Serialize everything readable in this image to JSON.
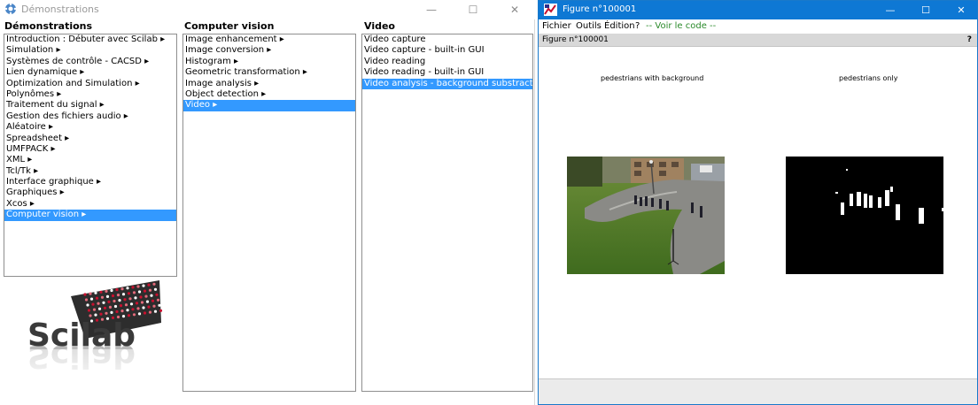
{
  "demo_window": {
    "title": "Démonstrations",
    "minimize_glyph": "—",
    "maximize_glyph": "☐",
    "close_glyph": "✕",
    "columns": [
      {
        "header": "Démonstrations",
        "items": [
          {
            "label": "Introduction : Débuter avec Scilab ▸",
            "selected": false
          },
          {
            "label": "Simulation ▸",
            "selected": false
          },
          {
            "label": "Systèmes de contrôle - CACSD ▸",
            "selected": false
          },
          {
            "label": "Lien dynamique ▸",
            "selected": false
          },
          {
            "label": "Optimization and Simulation ▸",
            "selected": false
          },
          {
            "label": "Polynômes ▸",
            "selected": false
          },
          {
            "label": "Traitement du signal ▸",
            "selected": false
          },
          {
            "label": "Gestion des fichiers audio ▸",
            "selected": false
          },
          {
            "label": "Aléatoire ▸",
            "selected": false
          },
          {
            "label": "Spreadsheet ▸",
            "selected": false
          },
          {
            "label": "UMFPACK ▸",
            "selected": false
          },
          {
            "label": "XML ▸",
            "selected": false
          },
          {
            "label": "Tcl/Tk ▸",
            "selected": false
          },
          {
            "label": "Interface graphique ▸",
            "selected": false
          },
          {
            "label": "Graphiques ▸",
            "selected": false
          },
          {
            "label": "Xcos ▸",
            "selected": false
          },
          {
            "label": "Computer vision ▸",
            "selected": true
          }
        ]
      },
      {
        "header": "Computer vision",
        "items": [
          {
            "label": "Image enhancement ▸",
            "selected": false
          },
          {
            "label": "Image conversion ▸",
            "selected": false
          },
          {
            "label": "Histogram ▸",
            "selected": false
          },
          {
            "label": "Geometric transformation ▸",
            "selected": false
          },
          {
            "label": "Image analysis ▸",
            "selected": false
          },
          {
            "label": "Object detection ▸",
            "selected": false
          },
          {
            "label": "Video ▸",
            "selected": true
          }
        ]
      },
      {
        "header": "Video",
        "items": [
          {
            "label": "Video capture",
            "selected": false
          },
          {
            "label": "Video capture - built-in GUI",
            "selected": false
          },
          {
            "label": "Video reading",
            "selected": false
          },
          {
            "label": "Video reading - built-in GUI",
            "selected": false
          },
          {
            "label": "Video analysis - background substraction",
            "selected": true
          }
        ]
      }
    ],
    "logo": {
      "text": "Scilab"
    }
  },
  "figure_window": {
    "title": "Figure n°100001",
    "minimize_glyph": "—",
    "maximize_glyph": "☐",
    "close_glyph": "✕",
    "menu": {
      "fichier": "Fichier",
      "outils": "Outils",
      "edition": "Édition",
      "help": "?",
      "voir_code": "-- Voir le code --"
    },
    "subtitle": "Figure n°100001",
    "help_glyph": "?",
    "axes": [
      {
        "title": "pedestrians with background",
        "content": "color video frame"
      },
      {
        "title": "pedestrians only",
        "content": "foreground mask"
      }
    ]
  },
  "colors": {
    "selection": "#3399ff",
    "figure_titlebar": "#0e78d4",
    "voir_code": "#2b8a2b",
    "scilab_red": "#c8102e"
  }
}
